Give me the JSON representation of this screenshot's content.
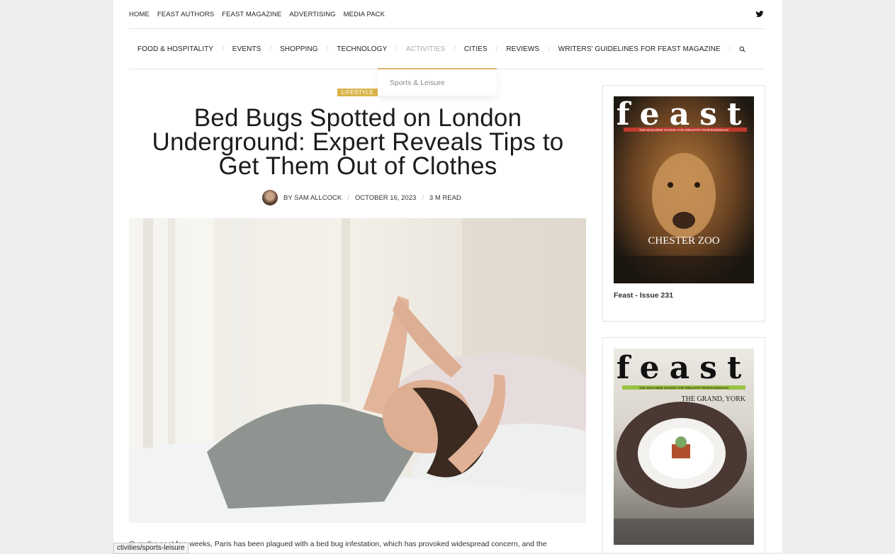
{
  "top_nav": [
    "HOME",
    "FEAST AUTHORS",
    "FEAST MAGAZINE",
    "ADVERTISING",
    "MEDIA PACK"
  ],
  "main_nav": [
    {
      "label": "FOOD & HOSPITALITY",
      "active": false
    },
    {
      "label": "EVENTS",
      "active": false
    },
    {
      "label": "SHOPPING",
      "active": false
    },
    {
      "label": "TECHNOLOGY",
      "active": false
    },
    {
      "label": "ACTIVITIES",
      "active": true
    },
    {
      "label": "CITIES",
      "active": false
    },
    {
      "label": "REVIEWS",
      "active": false
    },
    {
      "label": "WRITERS' GUIDELINES FOR FEAST MAGAZINE",
      "active": false
    }
  ],
  "dropdown": {
    "item": "Sports & Leisure"
  },
  "article": {
    "category": "LIFESTYLE",
    "title": "Bed Bugs Spotted on London Underground: Expert Reveals Tips to Get Them Out of Clothes",
    "author": "BY SAM ALLCOCK",
    "date": "OCTOBER 16, 2023",
    "read_time": "3 M READ",
    "excerpt": "Over the past few weeks, Paris has been plagued with a bed bug infestation, which has provoked widespread concern, and the"
  },
  "sidebar": {
    "magazine1": {
      "brand": "feast",
      "tagline": "THE MAGAZINE CHOICE FOR INDUSTRY PROFESSIONALS",
      "headline": "CHESTER ZOO",
      "caption": "Feast - Issue 231"
    },
    "magazine2": {
      "brand": "feast",
      "tagline": "THE MAGAZINE CHOICE FOR INDUSTRY PROFESSIONALS",
      "headline": "THE GRAND, YORK"
    }
  },
  "status_bar": "ctivities/sports-leisure",
  "colors": {
    "accent": "#d9b349",
    "dropdown_border": "#d9b86c"
  }
}
